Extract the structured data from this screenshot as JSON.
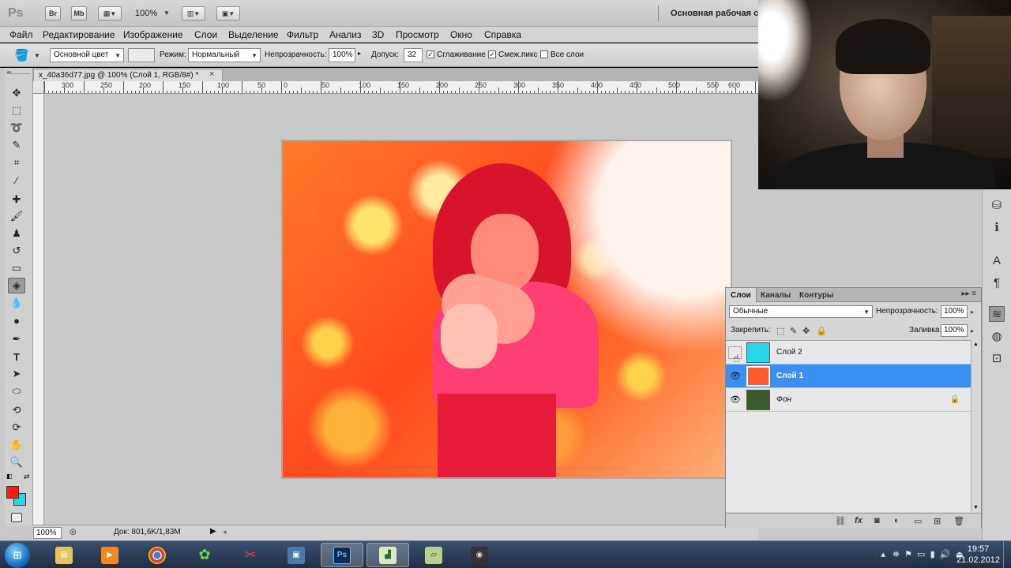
{
  "appbar": {
    "logo": "Ps",
    "btn_bridge": "Br",
    "btn_minibridge": "Mb",
    "zoom": "100%",
    "workspace": "Основная рабочая с"
  },
  "menu": [
    "Файл",
    "Редактирование",
    "Изображение",
    "Слои",
    "Выделение",
    "Фильтр",
    "Анализ",
    "3D",
    "Просмотр",
    "Окно",
    "Справка"
  ],
  "options": {
    "fill_source": "Основной цвет",
    "mode_label": "Режим:",
    "mode_value": "Нормальный",
    "opacity_label": "Непрозрачность:",
    "opacity_value": "100%",
    "tolerance_label": "Допуск:",
    "tolerance_value": "32",
    "antialias_label": "Сглаживание",
    "contiguous_label": "Смеж.пикс",
    "all_layers_label": "Все слои"
  },
  "document": {
    "tab_title": "x_40a36d77.jpg @ 100% (Слой 1, RGB/8#) *",
    "tab_close": "×",
    "ruler_labels": [
      "300",
      "250",
      "200",
      "150",
      "100",
      "50",
      "0",
      "50",
      "100",
      "150",
      "200",
      "250",
      "300",
      "350",
      "400",
      "450",
      "500",
      "550",
      "600"
    ]
  },
  "status": {
    "zoom": "100%",
    "doc_info": "Док: 801,6K/1,83M"
  },
  "tools": [
    "move-tool",
    "marquee-tool",
    "lasso-tool",
    "quick-select-tool",
    "crop-tool",
    "eyedropper-tool",
    "healing-brush-tool",
    "brush-tool",
    "clone-stamp-tool",
    "history-brush-tool",
    "eraser-tool",
    "paint-bucket-tool",
    "blur-tool",
    "dodge-tool",
    "pen-tool",
    "type-tool",
    "path-select-tool",
    "shape-tool",
    "3d-rotate-tool",
    "3d-orbit-tool",
    "hand-tool",
    "zoom-tool"
  ],
  "colors": {
    "foreground": "#ff1a1a",
    "background": "#27d9e8",
    "selection": "#3b8ff0"
  },
  "layers_panel": {
    "tabs": [
      "Слои",
      "Каналы",
      "Контуры"
    ],
    "blend_mode": "Обычные",
    "opacity_label": "Непрозрачность:",
    "opacity_value": "100%",
    "lock_label": "Закрепить:",
    "fill_label": "Заливка:",
    "fill_value": "100%",
    "layers": [
      {
        "name": "Слой 2",
        "visible": false,
        "selected": false,
        "thumb_color": "#27d9e8"
      },
      {
        "name": "Слой 1",
        "visible": true,
        "selected": true,
        "thumb_color": "#ff5a2a"
      },
      {
        "name": "Фон",
        "visible": true,
        "selected": false,
        "locked": true,
        "thumb_color": "#3a5a2a"
      }
    ]
  },
  "taskbar": {
    "start_label": "⊞",
    "apps": [
      "explorer",
      "media-player",
      "chrome",
      "flower-app",
      "scissors-app",
      "camera-app",
      "photoshop",
      "chart-app",
      "notes-app",
      "video-app"
    ],
    "photoshop_label": "Ps",
    "time": "19:57",
    "date": "21.02.2012"
  }
}
